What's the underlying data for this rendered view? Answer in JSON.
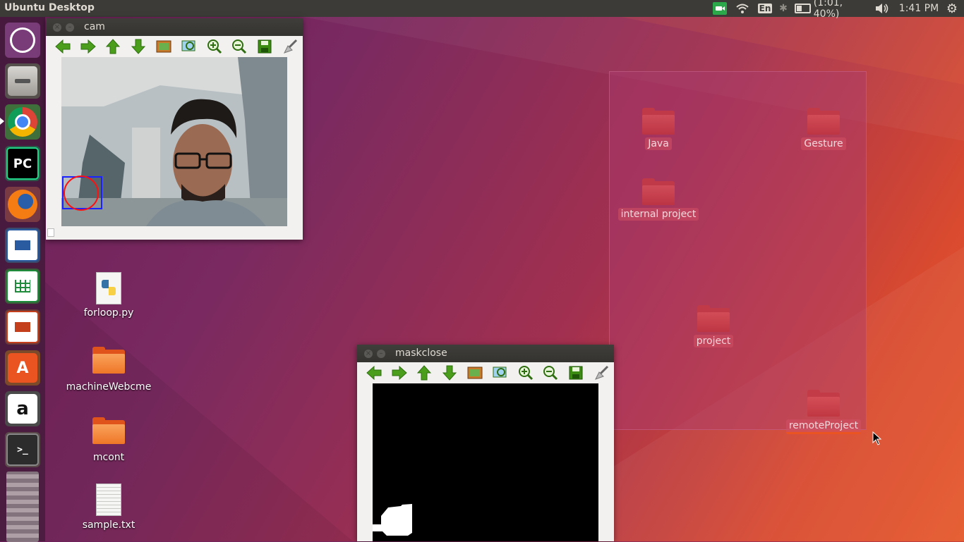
{
  "panel": {
    "title": "Ubuntu Desktop",
    "keyboard_layout": "En",
    "battery": "(1:01, 40%)",
    "time": "1:41 PM",
    "icons": [
      "camera-indicator-icon",
      "wifi-icon",
      "keyboard-icon",
      "bluetooth-icon",
      "battery-icon",
      "volume-icon",
      "settings-gear-icon"
    ]
  },
  "launcher": {
    "items": [
      {
        "name": "ubuntu-dash",
        "label": "Ubuntu"
      },
      {
        "name": "files",
        "label": "Files"
      },
      {
        "name": "chrome",
        "label": "Google Chrome"
      },
      {
        "name": "pycharm",
        "label": "PC"
      },
      {
        "name": "firefox",
        "label": "Firefox"
      },
      {
        "name": "writer",
        "label": "LibreOffice Writer"
      },
      {
        "name": "calc",
        "label": "LibreOffice Calc"
      },
      {
        "name": "impress",
        "label": "LibreOffice Impress"
      },
      {
        "name": "software-center",
        "label": "Ubuntu Software"
      },
      {
        "name": "amazon",
        "label": "a"
      },
      {
        "name": "terminal",
        "label": ">_"
      }
    ]
  },
  "desktop_icons": [
    {
      "label": "forloop.py",
      "type": "python"
    },
    {
      "label": "machineWebcme",
      "type": "folder"
    },
    {
      "label": "mcont",
      "type": "folder"
    },
    {
      "label": "sample.txt",
      "type": "text"
    }
  ],
  "selected_icons": [
    {
      "label": "Java"
    },
    {
      "label": "Gesture"
    },
    {
      "label": "internal project"
    },
    {
      "label": "project"
    },
    {
      "label": "remoteProject"
    }
  ],
  "windows": {
    "cam": {
      "title": "cam"
    },
    "maskclose": {
      "title": "maskclose"
    }
  },
  "toolbar_buttons": [
    "back",
    "forward",
    "up",
    "down",
    "image",
    "zoom-fit",
    "zoom-in",
    "zoom-out",
    "save",
    "clear"
  ],
  "colors": {
    "panel": "#3c3b37",
    "accent": "#e95420",
    "toolbar_green": "#4a9e1c"
  }
}
